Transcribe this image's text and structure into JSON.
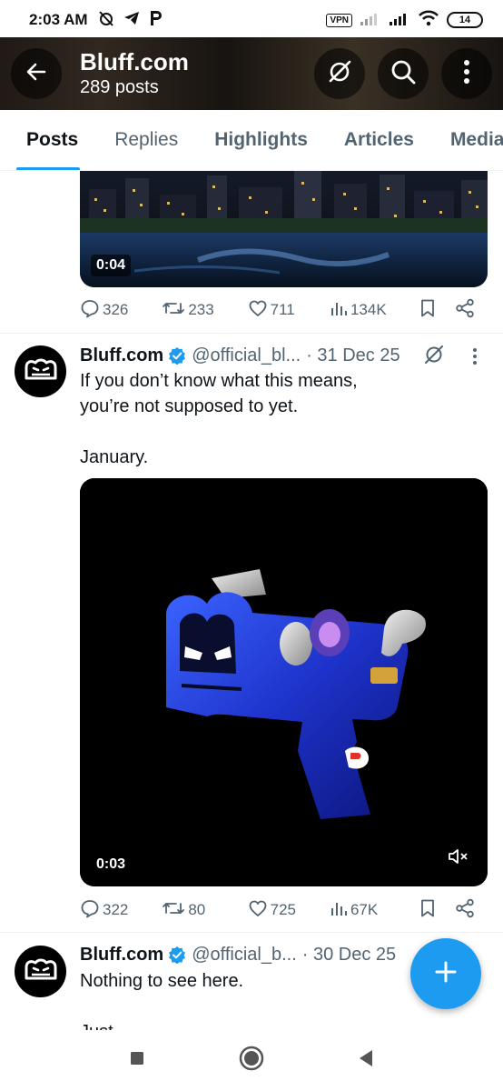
{
  "status_bar": {
    "time": "2:03 AM",
    "vpn": "VPN",
    "battery": "14"
  },
  "header": {
    "title": "Bluff.com",
    "subtitle": "289 posts"
  },
  "tabs": [
    {
      "label": "Posts",
      "active": true
    },
    {
      "label": "Replies"
    },
    {
      "label": "Highlights"
    },
    {
      "label": "Articles"
    },
    {
      "label": "Media"
    }
  ],
  "posts": [
    {
      "video_duration": "0:04",
      "stats": {
        "replies": "326",
        "reposts": "233",
        "likes": "711",
        "views": "134K"
      }
    },
    {
      "name": "Bluff.com",
      "handle": "@official_bl...",
      "date": "· 31 Dec 25",
      "text": "If you don’t know what this means,\nyou’re not supposed to yet.\n\nJanuary.",
      "video_duration": "0:03",
      "stats": {
        "replies": "322",
        "reposts": "80",
        "likes": "725",
        "views": "67K"
      }
    },
    {
      "name": "Bluff.com",
      "handle": "@official_b...",
      "date": "· 30 Dec 25",
      "text": "Nothing to see here.\n\nJust"
    }
  ],
  "colors": {
    "accent": "#1d9bf0",
    "muted": "#536471"
  }
}
